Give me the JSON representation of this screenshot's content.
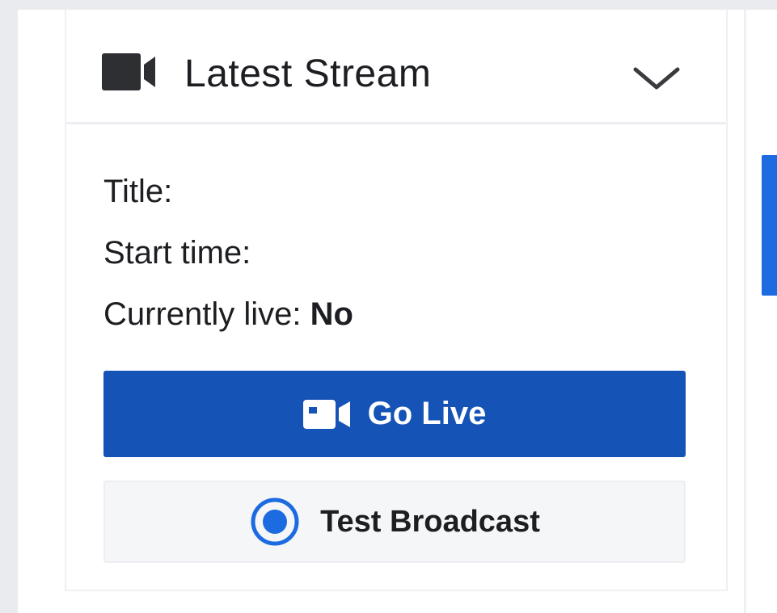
{
  "latest_stream": {
    "header": {
      "title": "Latest Stream",
      "icon": "video-camera-icon",
      "toggle_icon": "chevron-down-icon"
    },
    "fields": {
      "title_label": "Title:",
      "title_value": "",
      "start_time_label": "Start time:",
      "start_time_value": "",
      "currently_live_label": "Currently live:",
      "currently_live_value": "No"
    },
    "actions": {
      "go_live_label": "Go Live",
      "go_live_icon": "video-camera-icon",
      "test_broadcast_label": "Test Broadcast",
      "test_broadcast_icon": "radio-target-icon"
    }
  },
  "colors": {
    "primary_button": "#1553b6",
    "accent_blue": "#1c6be0",
    "secondary_button": "#f5f6f7",
    "text": "#1c1e21",
    "page_background": "#e9ebee"
  }
}
